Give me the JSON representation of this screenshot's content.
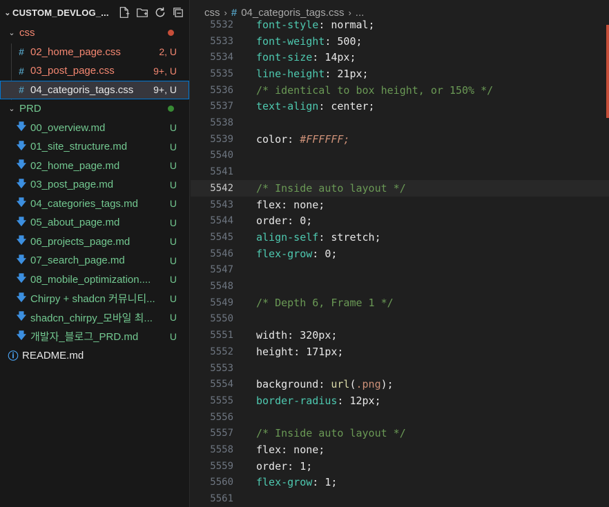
{
  "explorer": {
    "title": "CUSTOM_DEVLOG_...",
    "actions": [
      "new-file-icon",
      "new-folder-icon",
      "refresh-icon",
      "collapse-all-icon"
    ]
  },
  "tree": {
    "css_folder": {
      "label": "css"
    },
    "css_files": [
      {
        "label": "02_home_page.css",
        "status": "2, U"
      },
      {
        "label": "03_post_page.css",
        "status": "9+, U"
      },
      {
        "label": "04_categoris_tags.css",
        "status": "9+, U"
      }
    ],
    "prd_folder": {
      "label": "PRD"
    },
    "prd_files": [
      {
        "label": "00_overview.md",
        "status": "U"
      },
      {
        "label": "01_site_structure.md",
        "status": "U"
      },
      {
        "label": "02_home_page.md",
        "status": "U"
      },
      {
        "label": "03_post_page.md",
        "status": "U"
      },
      {
        "label": "04_categories_tags.md",
        "status": "U"
      },
      {
        "label": "05_about_page.md",
        "status": "U"
      },
      {
        "label": "06_projects_page.md",
        "status": "U"
      },
      {
        "label": "07_search_page.md",
        "status": "U"
      },
      {
        "label": "08_mobile_optimization....",
        "status": "U"
      },
      {
        "label": "Chirpy + shadcn 커뮤니티...",
        "status": "U"
      },
      {
        "label": "shadcn_chirpy_모바일 최...",
        "status": "U"
      },
      {
        "label": "개발자_블로그_PRD.md",
        "status": "U"
      }
    ],
    "readme": {
      "label": "README.md"
    }
  },
  "breadcrumb": {
    "folder": "css",
    "file": "04_categoris_tags.css",
    "more": "..."
  },
  "code": {
    "top_partial": "font-style: normal;",
    "lines": [
      {
        "n": "5532",
        "t": ""
      },
      {
        "n": "5533",
        "t": "font-weight: 500;"
      },
      {
        "n": "5534",
        "t": "font-size: 14px;"
      },
      {
        "n": "5535",
        "t": "line-height: 21px;"
      },
      {
        "n": "5536",
        "t": "/* identical to box height, or 150% */"
      },
      {
        "n": "5537",
        "t": "text-align: center;"
      },
      {
        "n": "5538",
        "t": ""
      },
      {
        "n": "5539",
        "t": "color: #FFFFFF;"
      },
      {
        "n": "5540",
        "t": ""
      },
      {
        "n": "5541",
        "t": ""
      },
      {
        "n": "5542",
        "t": "/* Inside auto layout */"
      },
      {
        "n": "5543",
        "t": "flex: none;"
      },
      {
        "n": "5544",
        "t": "order: 0;"
      },
      {
        "n": "5545",
        "t": "align-self: stretch;"
      },
      {
        "n": "5546",
        "t": "flex-grow: 0;"
      },
      {
        "n": "5547",
        "t": ""
      },
      {
        "n": "5548",
        "t": ""
      },
      {
        "n": "5549",
        "t": "/* Depth 6, Frame 1 */"
      },
      {
        "n": "5550",
        "t": ""
      },
      {
        "n": "5551",
        "t": "width: 320px;"
      },
      {
        "n": "5552",
        "t": "height: 171px;"
      },
      {
        "n": "5553",
        "t": ""
      },
      {
        "n": "5554",
        "t": "background: url(.png);"
      },
      {
        "n": "5555",
        "t": "border-radius: 12px;"
      },
      {
        "n": "5556",
        "t": ""
      },
      {
        "n": "5557",
        "t": "/* Inside auto layout */"
      },
      {
        "n": "5558",
        "t": "flex: none;"
      },
      {
        "n": "5559",
        "t": "order: 1;"
      },
      {
        "n": "5560",
        "t": "flex-grow: 1;"
      },
      {
        "n": "5561",
        "t": ""
      }
    ],
    "active_line": "5542"
  },
  "colors": {
    "modified": "#f48771",
    "untracked": "#73c991",
    "folder_dot_css": "#c74e39",
    "folder_dot_prd": "#388a34"
  }
}
